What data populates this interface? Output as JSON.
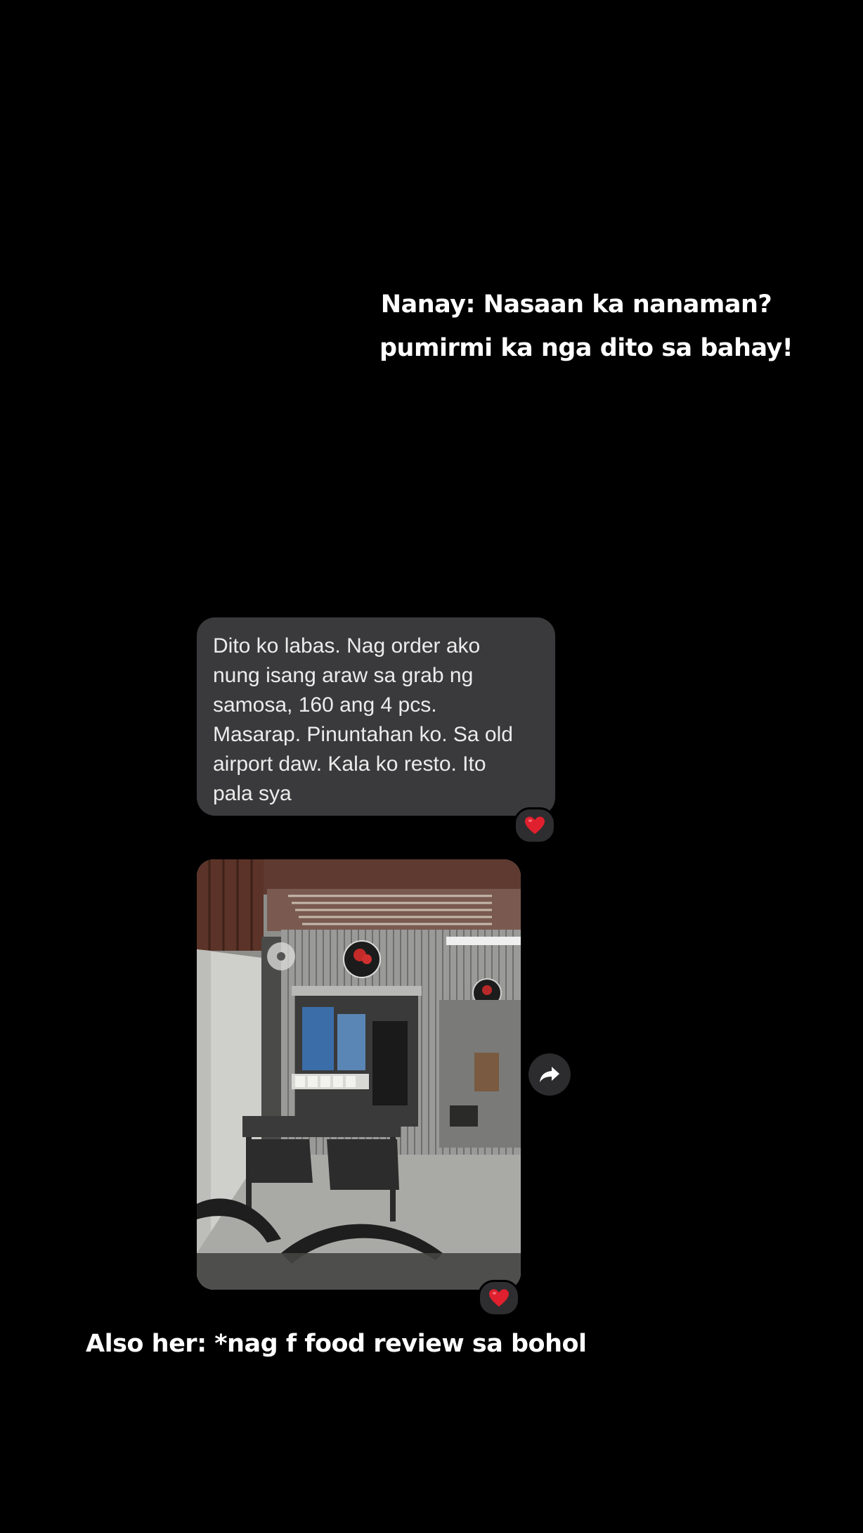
{
  "captions": {
    "top_line1": "Nanay: Nasaan ka nanaman?",
    "top_line2": "pumirmi ka nga dito sa bahay!",
    "bottom": "Also her: *nag f food review sa bohol"
  },
  "chat": {
    "message": {
      "lines": [
        "Dito ko labas. Nag order ako",
        "nung isang araw sa grab ng",
        "samosa, 160 ang 4 pcs.",
        "Masarap. Pinuntahan ko. Sa old",
        "airport daw. Kala ko resto. Ito",
        "pala sya"
      ],
      "reaction": "heart-icon"
    },
    "photo": {
      "reaction": "heart-icon"
    },
    "forward_icon": "forward-arrow-icon"
  },
  "colors": {
    "background": "#000000",
    "bubble": "#3a3a3c",
    "text": "#ffffff",
    "heart": "#e0202e"
  }
}
